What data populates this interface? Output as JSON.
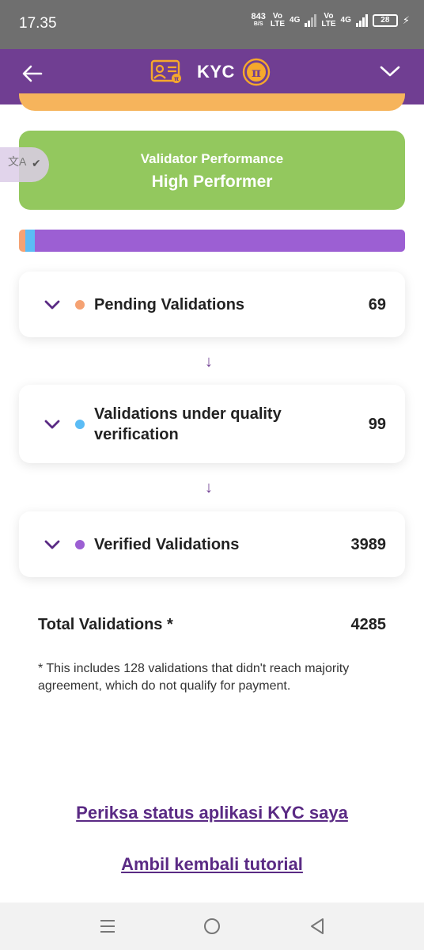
{
  "status_bar": {
    "time": "17.35",
    "net_speed": "843",
    "net_speed_unit": "B/S",
    "volte1_top": "Vo",
    "volte1_bottom": "LTE",
    "sig1_label": "4G",
    "volte2_top": "Vo",
    "volte2_bottom": "LTE",
    "sig2_label": "4G",
    "battery": "28"
  },
  "header": {
    "title": "KYC",
    "back_icon": "arrow-left-icon",
    "menu_icon": "chevron-down-icon",
    "pi_icon": "pi-coin-icon",
    "kyc_icon": "id-card-icon"
  },
  "translate_chip": {
    "icon": "translate-icon"
  },
  "performance": {
    "label": "Validator Performance",
    "value": "High Performer",
    "color": "#93c85e"
  },
  "progress": {
    "segments": [
      {
        "name": "Pending Validations",
        "value": 69,
        "color": "#f5a273"
      },
      {
        "name": "Validations under quality verification",
        "value": 99,
        "color": "#5bbcf5"
      },
      {
        "name": "Verified Validations",
        "value": 3989,
        "color": "#9c5fd3"
      }
    ]
  },
  "validations": [
    {
      "label": "Pending Validations",
      "count": "69",
      "dot_color": "#f5a273"
    },
    {
      "label": "Validations under quality verification",
      "count": "99",
      "dot_color": "#5bbcf5"
    },
    {
      "label": "Verified Validations",
      "count": "3989",
      "dot_color": "#9c5fd3"
    }
  ],
  "arrows": [
    "↓",
    "↓"
  ],
  "totals": {
    "label": "Total Validations *",
    "value": "4285",
    "footnote": "* This includes 128 validations that didn't reach majority agreement, which do not qualify for payment."
  },
  "links": {
    "check_status": "Periksa status aplikasi KYC saya",
    "tutorial": "Ambil kembali tutorial"
  },
  "colors": {
    "header_bg": "#703e92",
    "accent": "#f6a82c",
    "link": "#5a2a84"
  },
  "nav": {
    "recent_icon": "recents-icon",
    "home_icon": "home-icon",
    "back_icon": "back-triangle-icon"
  }
}
